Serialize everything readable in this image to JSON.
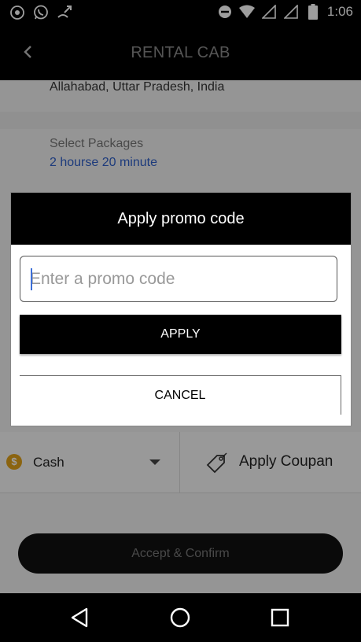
{
  "status_bar": {
    "time": "1:06",
    "icons": [
      "notification-icon",
      "whatsapp-icon",
      "missed-call-icon",
      "do-not-disturb-icon",
      "wifi-icon",
      "signal-icon",
      "signal-icon-2",
      "battery-icon"
    ]
  },
  "header": {
    "title": "RENTAL CAB",
    "back_icon": "chevron-left-icon"
  },
  "location": {
    "value": "Allahabad, Uttar Pradesh, India"
  },
  "packages": {
    "label": "Select Packages",
    "value": "2 hourse 20 minute"
  },
  "payment": {
    "method": "Cash",
    "coin_symbol": "$",
    "coupon_label": "Apply Coupan"
  },
  "confirm_button": {
    "label": "Accept & Confirm"
  },
  "dialog": {
    "title": "Apply promo code",
    "input_placeholder": "Enter a promo code",
    "input_value": "",
    "apply_label": "APPLY",
    "cancel_label": "CANCEL"
  },
  "nav_bar": {
    "icons": [
      "back-triangle-icon",
      "home-circle-icon",
      "recents-square-icon"
    ]
  },
  "colors": {
    "accent_blue": "#2f5fc8",
    "bar_black": "#000000",
    "coin_gold": "#e0a21a"
  }
}
